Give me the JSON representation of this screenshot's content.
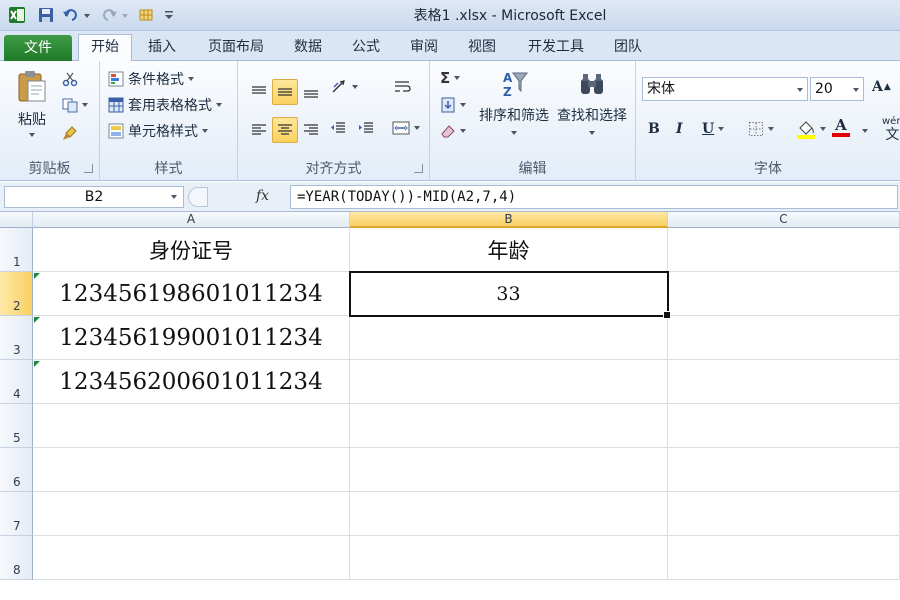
{
  "window": {
    "title": "表格1 .xlsx - Microsoft Excel"
  },
  "ribbon": {
    "tabs": [
      "文件",
      "开始",
      "插入",
      "页面布局",
      "数据",
      "公式",
      "审阅",
      "视图",
      "开发工具",
      "团队"
    ],
    "active_tab": "开始",
    "clipboard": {
      "paste": "粘贴",
      "label": "剪贴板"
    },
    "styles": {
      "conditional_format": "条件格式",
      "table_format": "套用表格格式",
      "cell_styles": "单元格样式",
      "label": "样式"
    },
    "alignment": {
      "label": "对齐方式"
    },
    "editing": {
      "sort_filter": "排序和筛选",
      "find_select": "查找和选择",
      "label": "编辑"
    },
    "font": {
      "name": "宋体",
      "size": "20",
      "bold": "B",
      "italic": "I",
      "underline": "U",
      "font_color": "A",
      "label": "字体",
      "grow": "A",
      "wen": "wén",
      "wen_char": "文"
    }
  },
  "formula_bar": {
    "name_box": "B2",
    "fx": "fx",
    "formula": "=YEAR(TODAY())-MID(A2,7,4)"
  },
  "sheet": {
    "columns": [
      "A",
      "B",
      "C"
    ],
    "active_column": "B",
    "rows": [
      "1",
      "2",
      "3",
      "4",
      "5",
      "6",
      "7",
      "8"
    ],
    "active_row": "2",
    "cells": {
      "A1": "身份证号",
      "B1": "年龄",
      "A2": "123456198601011234",
      "B2": "33",
      "A3": "123456199001011234",
      "A4": "123456200601011234"
    }
  },
  "colors": {
    "file_tab": "#2a8a32",
    "selection_highlight": "#fbd25f",
    "text_flag": "#1e8a3d"
  }
}
